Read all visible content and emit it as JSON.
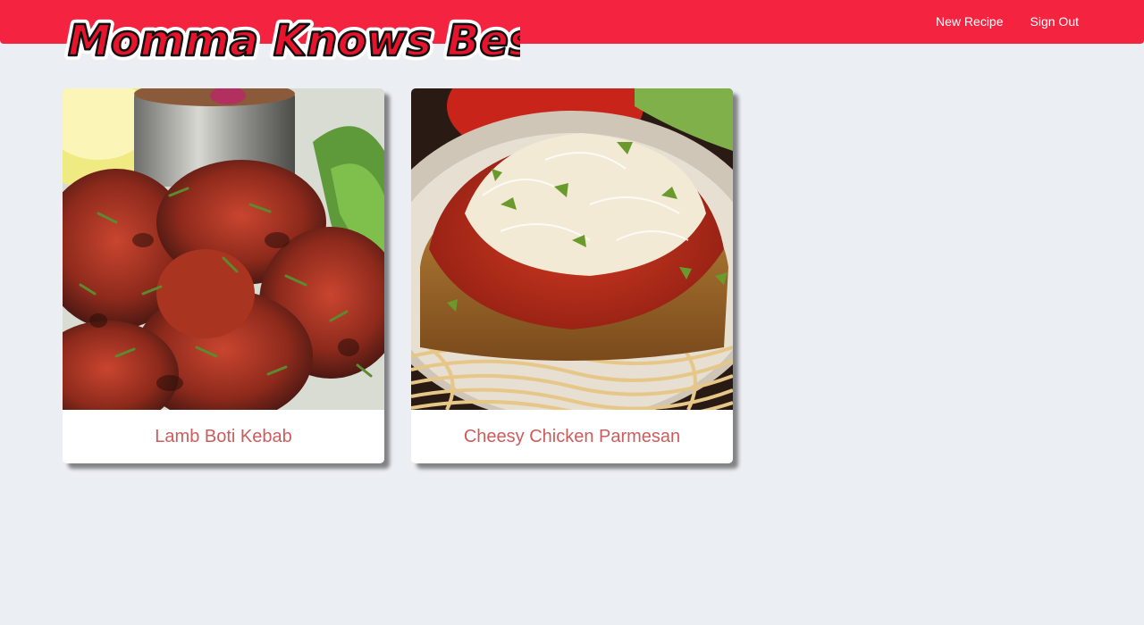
{
  "header": {
    "brand": "Momma Knows Best!",
    "nav": [
      {
        "label": "New Recipe"
      },
      {
        "label": "Sign Out"
      }
    ]
  },
  "recipes": [
    {
      "title": "Lamb Boti Kebab",
      "image": "lamb-kebab-photo"
    },
    {
      "title": "Cheesy Chicken Parmesan",
      "image": "chicken-parmesan-photo"
    }
  ],
  "colors": {
    "navbar": "#f4233f",
    "background": "#ebeef3",
    "card_title": "#cd5c5c",
    "nav_text": "#ffffff"
  }
}
